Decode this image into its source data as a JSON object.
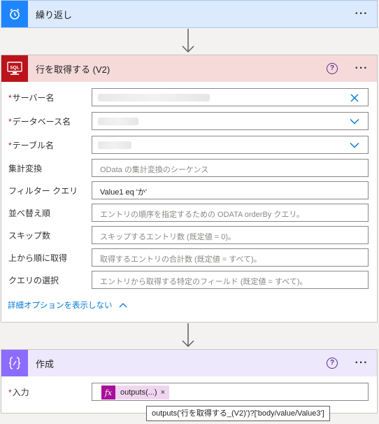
{
  "repeat": {
    "title": "繰り返し",
    "more": "···",
    "color": "#1f85ff",
    "icon": "alarm-clock-icon"
  },
  "get_rows": {
    "title": "行を取得する (V2)",
    "help": "?",
    "more": "···",
    "icon_text": "SQL",
    "color": "#ba141a",
    "header_bg": "#f6dada",
    "fields": [
      {
        "label": "サーバー名",
        "required": true,
        "value": "",
        "placeholder": "",
        "control": "clear"
      },
      {
        "label": "データベース名",
        "required": true,
        "value": "",
        "placeholder": "",
        "control": "dropdown"
      },
      {
        "label": "テーブル名",
        "required": true,
        "value": "",
        "placeholder": "",
        "control": "dropdown"
      },
      {
        "label": "集計変換",
        "required": false,
        "value": "",
        "placeholder": "OData の集計変換のシーケンス"
      },
      {
        "label": "フィルター クエリ",
        "required": false,
        "value": "Value1 eq 'か'",
        "placeholder": ""
      },
      {
        "label": "並べ替え順",
        "required": false,
        "value": "",
        "placeholder": "エントリの順序を指定するための ODATA orderBy クエリ。"
      },
      {
        "label": "スキップ数",
        "required": false,
        "value": "",
        "placeholder": "スキップするエントリ数 (既定値 = 0)。"
      },
      {
        "label": "上から順に取得",
        "required": false,
        "value": "",
        "placeholder": "取得するエントリの合計数 (既定値 = すべて)。"
      },
      {
        "label": "クエリの選択",
        "required": false,
        "value": "",
        "placeholder": "エントリから取得する特定のフィールド (既定値 = すべて)。"
      }
    ],
    "advanced_label": "詳細オプションを表示しない"
  },
  "compose": {
    "title": "作成",
    "help": "?",
    "more": "···",
    "color": "#8c6cff",
    "header_bg": "#ede8fb",
    "icon_text": "{ }",
    "input_label": "入力",
    "token_fx": "fx",
    "token_label": "outputs(...)",
    "token_remove": "×",
    "tooltip": "outputs('行を取得する_(V2)')?['body/value/Value3']"
  }
}
